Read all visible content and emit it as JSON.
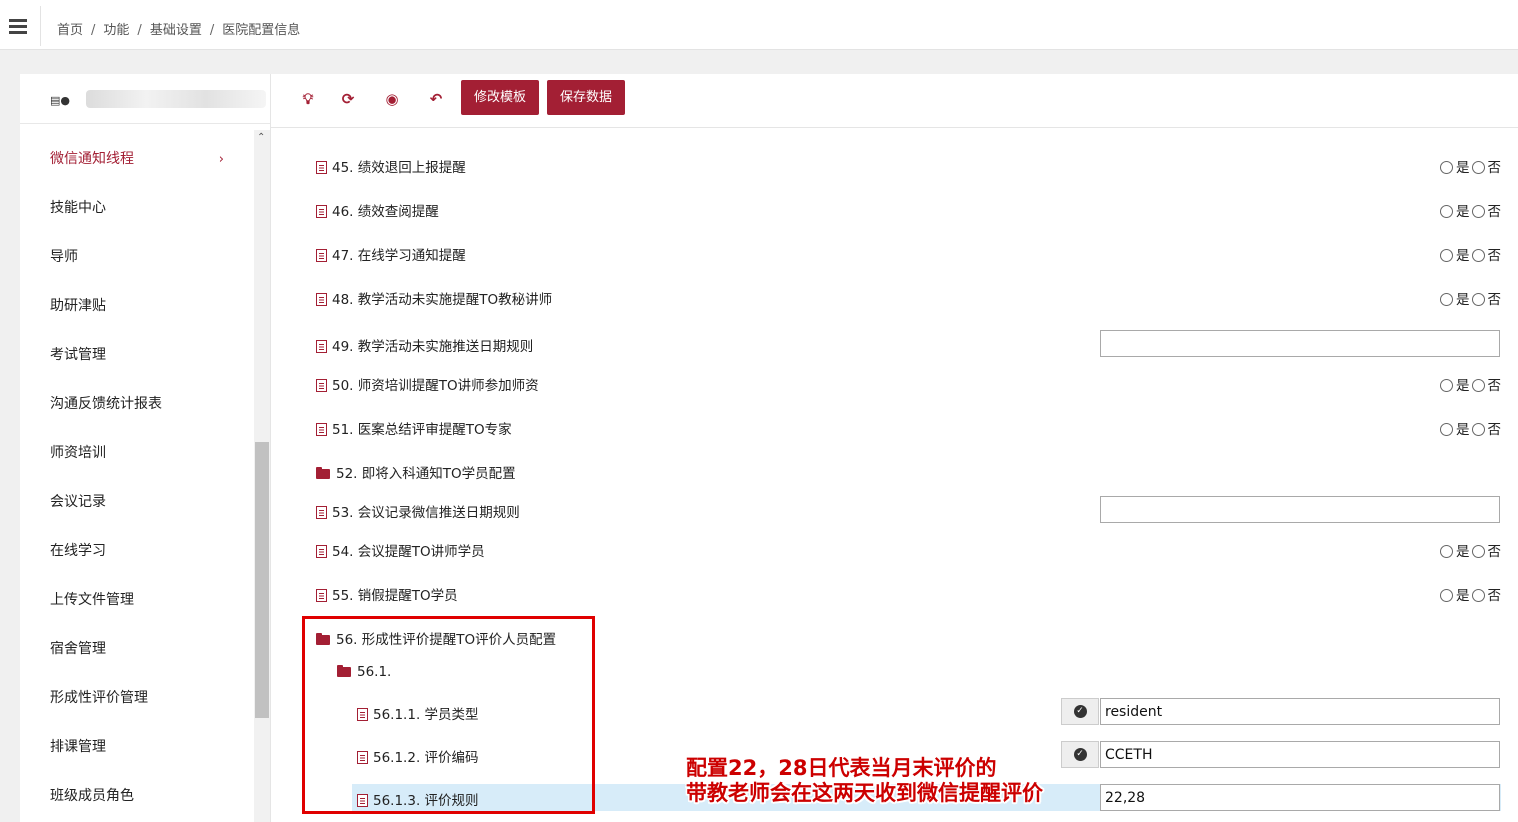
{
  "breadcrumb": [
    "首页",
    "功能",
    "基础设置",
    "医院配置信息"
  ],
  "sidebar": {
    "logo_text": "▤●",
    "items": [
      {
        "label": "微信通知线程",
        "active": true
      },
      {
        "label": "技能中心"
      },
      {
        "label": "导师"
      },
      {
        "label": "助研津贴"
      },
      {
        "label": "考试管理"
      },
      {
        "label": "沟通反馈统计报表"
      },
      {
        "label": "师资培训"
      },
      {
        "label": "会议记录"
      },
      {
        "label": "在线学习"
      },
      {
        "label": "上传文件管理"
      },
      {
        "label": "宿舍管理"
      },
      {
        "label": "形成性评价管理"
      },
      {
        "label": "排课管理"
      },
      {
        "label": "班级成员角色"
      }
    ]
  },
  "toolbar": {
    "icons": [
      "bulb-icon",
      "refresh-icon",
      "eye-slash-icon",
      "undo-icon"
    ],
    "edit_template": "修改模板",
    "save_data": "保存数据"
  },
  "radio": {
    "yes": "是",
    "no": "否"
  },
  "settings": [
    {
      "label": "45. 绩效退回上报提醒",
      "kind": "radio"
    },
    {
      "label": "46. 绩效查阅提醒",
      "kind": "radio"
    },
    {
      "label": "47. 在线学习通知提醒",
      "kind": "radio"
    },
    {
      "label": "48. 教学活动未实施提醒TO教秘讲师",
      "kind": "radio"
    },
    {
      "label": "49. 教学活动未实施推送日期规则",
      "kind": "text",
      "value": ""
    },
    {
      "label": "50. 师资培训提醒TO讲师参加师资",
      "kind": "radio"
    },
    {
      "label": "51. 医案总结评审提醒TO专家",
      "kind": "radio"
    },
    {
      "label": "52. 即将入科通知TO学员配置",
      "kind": "folder"
    },
    {
      "label": "53. 会议记录微信推送日期规则",
      "kind": "text",
      "value": ""
    },
    {
      "label": "54. 会议提醒TO讲师学员",
      "kind": "radio"
    },
    {
      "label": "55. 销假提醒TO学员",
      "kind": "radio"
    },
    {
      "label": "56. 形成性评价提醒TO评价人员配置",
      "kind": "folder-open"
    },
    {
      "label": "56.1.",
      "kind": "folder-open"
    },
    {
      "label": "56.1.1. 学员类型",
      "kind": "text-check",
      "value": "resident"
    },
    {
      "label": "56.1.2. 评价编码",
      "kind": "text-check",
      "value": "CCETH"
    },
    {
      "label": "56.1.3. 评价规则",
      "kind": "text",
      "value": "22,28"
    }
  ],
  "annotation": {
    "line1": "配置22，28日代表当月末评价的",
    "line2": "带教老师会在这两天收到微信提醒评价",
    "color": "#cc0000"
  },
  "colors": {
    "accent": "#a31f34",
    "highlight": "#d7ecf9"
  }
}
